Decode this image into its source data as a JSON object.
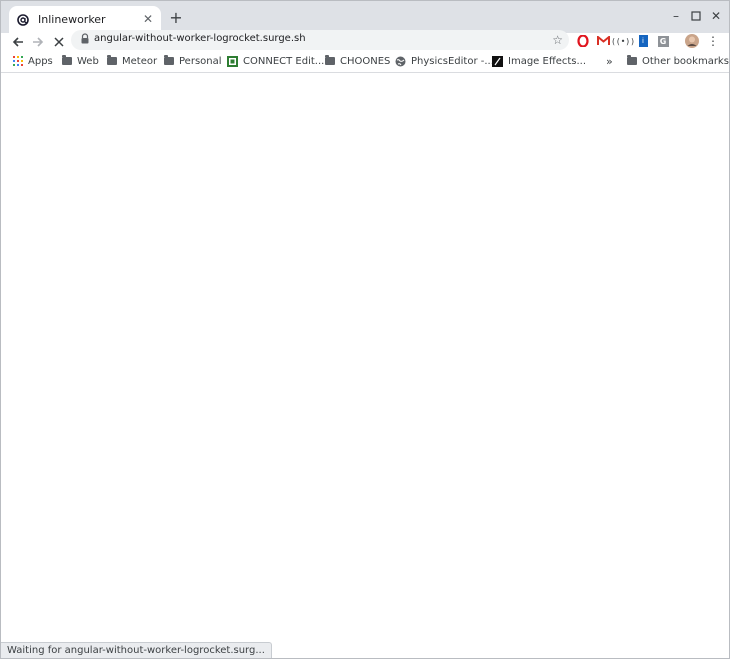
{
  "tab": {
    "title": "Inlineworker",
    "favicon": "at-sign-favicon-icon"
  },
  "toolbar": {
    "url": "angular-without-worker-logrocket.surge.sh",
    "extensions": [
      "opera-icon",
      "gmail-icon",
      "radio-signal-icon",
      "blue-badge-icon",
      "grammarly-icon"
    ]
  },
  "bookmarks": {
    "items": [
      {
        "label": "Apps",
        "icon": "apps-grid-icon"
      },
      {
        "label": "Web",
        "icon": "folder-icon"
      },
      {
        "label": "Meteor",
        "icon": "folder-icon"
      },
      {
        "label": "Personal",
        "icon": "folder-icon"
      },
      {
        "label": "CONNECT Edit...",
        "icon": "connect-site-icon"
      },
      {
        "label": "CHOONES",
        "icon": "folder-icon"
      },
      {
        "label": "PhysicsEditor -...",
        "icon": "globe-icon"
      },
      {
        "label": "Image Effects...",
        "icon": "image-effects-site-icon"
      }
    ],
    "overflow": "»",
    "other": "Other bookmarks"
  },
  "status": {
    "text": "Waiting for angular-without-worker-logrocket.surg..."
  },
  "colors": {
    "chrome_frame": "#dee1e6",
    "toolbar": "#ffffff",
    "omnibox": "#f1f3f4"
  }
}
